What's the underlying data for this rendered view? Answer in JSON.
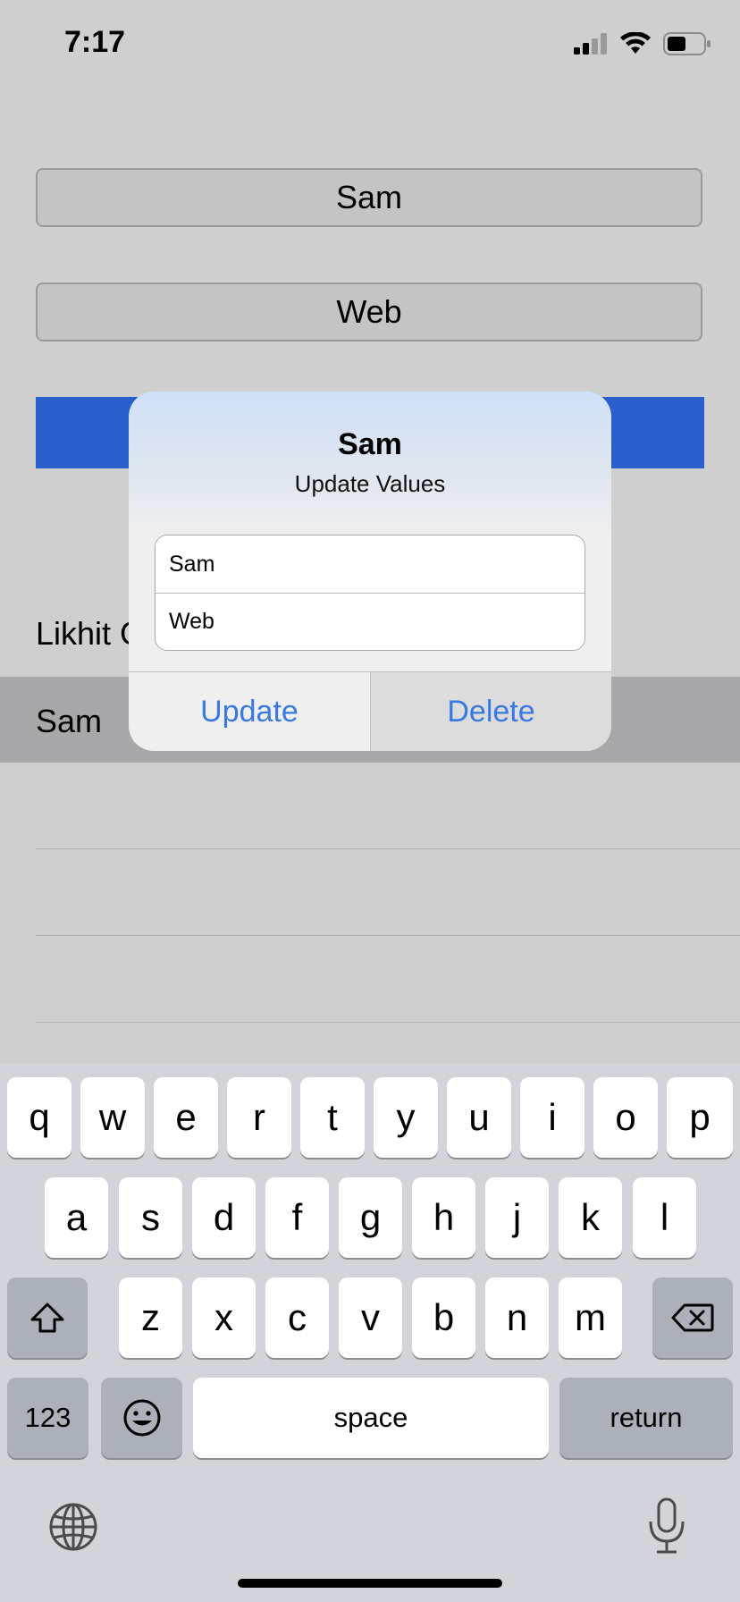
{
  "status_bar": {
    "time": "7:17"
  },
  "form": {
    "name_field": "Sam",
    "type_field": "Web",
    "list_header": "Likhit C",
    "selected_row": "Sam"
  },
  "alert": {
    "title": "Sam",
    "message": "Update Values",
    "name_value": "Sam",
    "type_value": "Web",
    "update_label": "Update",
    "delete_label": "Delete"
  },
  "keyboard": {
    "row1": [
      "q",
      "w",
      "e",
      "r",
      "t",
      "y",
      "u",
      "i",
      "o",
      "p"
    ],
    "row2": [
      "a",
      "s",
      "d",
      "f",
      "g",
      "h",
      "j",
      "k",
      "l"
    ],
    "row3": [
      "z",
      "x",
      "c",
      "v",
      "b",
      "n",
      "m"
    ],
    "numbers_label": "123",
    "space_label": "space",
    "return_label": "return"
  }
}
